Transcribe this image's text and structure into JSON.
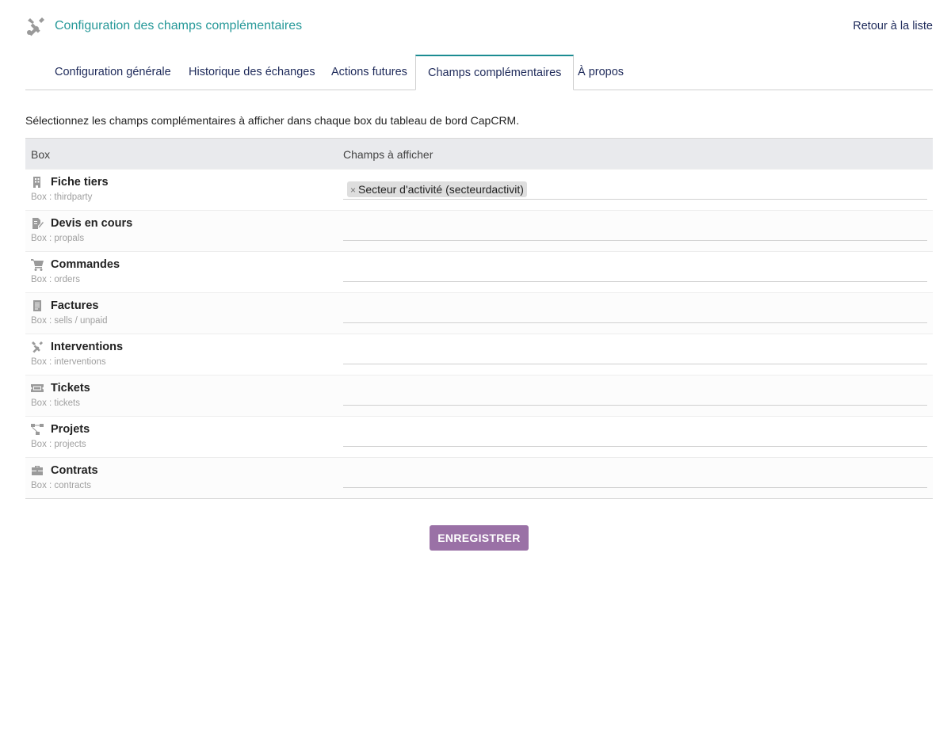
{
  "header": {
    "title": "Configuration des champs complémentaires",
    "back_link": "Retour à la liste",
    "icon": "tools-icon"
  },
  "tabs": [
    {
      "label": "Configuration générale",
      "active": false
    },
    {
      "label": "Historique des échanges",
      "active": false
    },
    {
      "label": "Actions futures",
      "active": false
    },
    {
      "label": "Champs complémentaires",
      "active": true
    },
    {
      "label": "À propos",
      "active": false
    }
  ],
  "description": "Sélectionnez les champs complémentaires à afficher dans chaque box du tableau de bord CapCRM.",
  "table": {
    "col_box": "Box",
    "col_fields": "Champs à afficher",
    "rows": [
      {
        "label": "Fiche tiers",
        "sub": "Box : thirdparty",
        "icon": "building-icon",
        "selected": [
          "Secteur d'activité (secteurdactivit)"
        ]
      },
      {
        "label": "Devis en cours",
        "sub": "Box : propals",
        "icon": "file-signature-icon",
        "selected": []
      },
      {
        "label": "Commandes",
        "sub": "Box : orders",
        "icon": "cart-icon",
        "selected": []
      },
      {
        "label": "Factures",
        "sub": "Box : sells / unpaid",
        "icon": "invoice-icon",
        "selected": []
      },
      {
        "label": "Interventions",
        "sub": "Box : interventions",
        "icon": "tools-icon",
        "selected": []
      },
      {
        "label": "Tickets",
        "sub": "Box : tickets",
        "icon": "ticket-icon",
        "selected": []
      },
      {
        "label": "Projets",
        "sub": "Box : projects",
        "icon": "project-diagram-icon",
        "selected": []
      },
      {
        "label": "Contrats",
        "sub": "Box : contracts",
        "icon": "briefcase-icon",
        "selected": []
      }
    ]
  },
  "save_button": "ENREGISTRER",
  "colors": {
    "title": "#279999",
    "tab_text": "#1e2a5a",
    "tab_active_border": "#1b8c92",
    "button_bg": "#9a71a6",
    "header_row_bg": "#e9eaed"
  }
}
